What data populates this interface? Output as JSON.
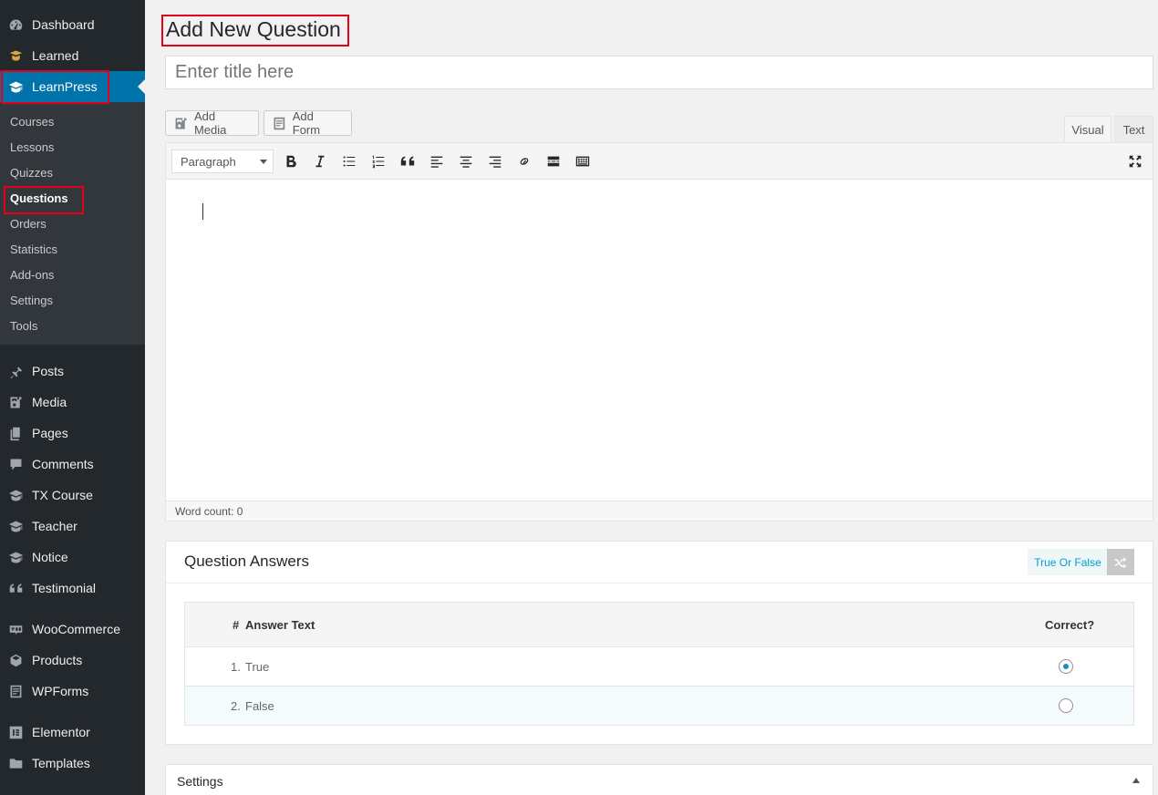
{
  "sidebar": {
    "top_items": [
      {
        "label": "Dashboard",
        "icon": "dashboard-icon"
      },
      {
        "label": "Learned",
        "icon": "learned-icon"
      },
      {
        "label": "LearnPress",
        "icon": "graduation-cap-icon"
      }
    ],
    "submenu": [
      "Courses",
      "Lessons",
      "Quizzes",
      "Questions",
      "Orders",
      "Statistics",
      "Add-ons",
      "Settings",
      "Tools"
    ],
    "bottom_items": [
      {
        "label": "Posts",
        "icon": "pushpin-icon"
      },
      {
        "label": "Media",
        "icon": "media-icon"
      },
      {
        "label": "Pages",
        "icon": "pages-icon"
      },
      {
        "label": "Comments",
        "icon": "comments-icon"
      },
      {
        "label": "TX Course",
        "icon": "graduation-cap-icon"
      },
      {
        "label": "Teacher",
        "icon": "graduation-cap-icon"
      },
      {
        "label": "Notice",
        "icon": "graduation-cap-icon"
      },
      {
        "label": "Testimonial",
        "icon": "quote-icon"
      },
      {
        "label": "WooCommerce",
        "icon": "woocommerce-icon"
      },
      {
        "label": "Products",
        "icon": "products-icon"
      },
      {
        "label": "WPForms",
        "icon": "wpforms-icon"
      },
      {
        "label": "Elementor",
        "icon": "elementor-icon"
      },
      {
        "label": "Templates",
        "icon": "folder-icon"
      }
    ],
    "active_color": "#0073aa"
  },
  "page": {
    "title": "Add New Question",
    "title_placeholder": "Enter title here"
  },
  "editor": {
    "add_media_label": "Add Media",
    "add_form_label": "Add Form",
    "tab_visual": "Visual",
    "tab_text": "Text",
    "format_value": "Paragraph",
    "word_count": "Word count: 0"
  },
  "answers_panel": {
    "title": "Question Answers",
    "type_label": "True Or False",
    "col_num": "#",
    "col_text": "Answer Text",
    "col_correct": "Correct?",
    "rows": [
      {
        "num": "1.",
        "text": "True",
        "correct": true
      },
      {
        "num": "2.",
        "text": "False",
        "correct": false
      }
    ]
  },
  "settings_panel": {
    "title": "Settings"
  },
  "colors": {
    "highlight": "#e2001a",
    "accent": "#00a0d2"
  }
}
